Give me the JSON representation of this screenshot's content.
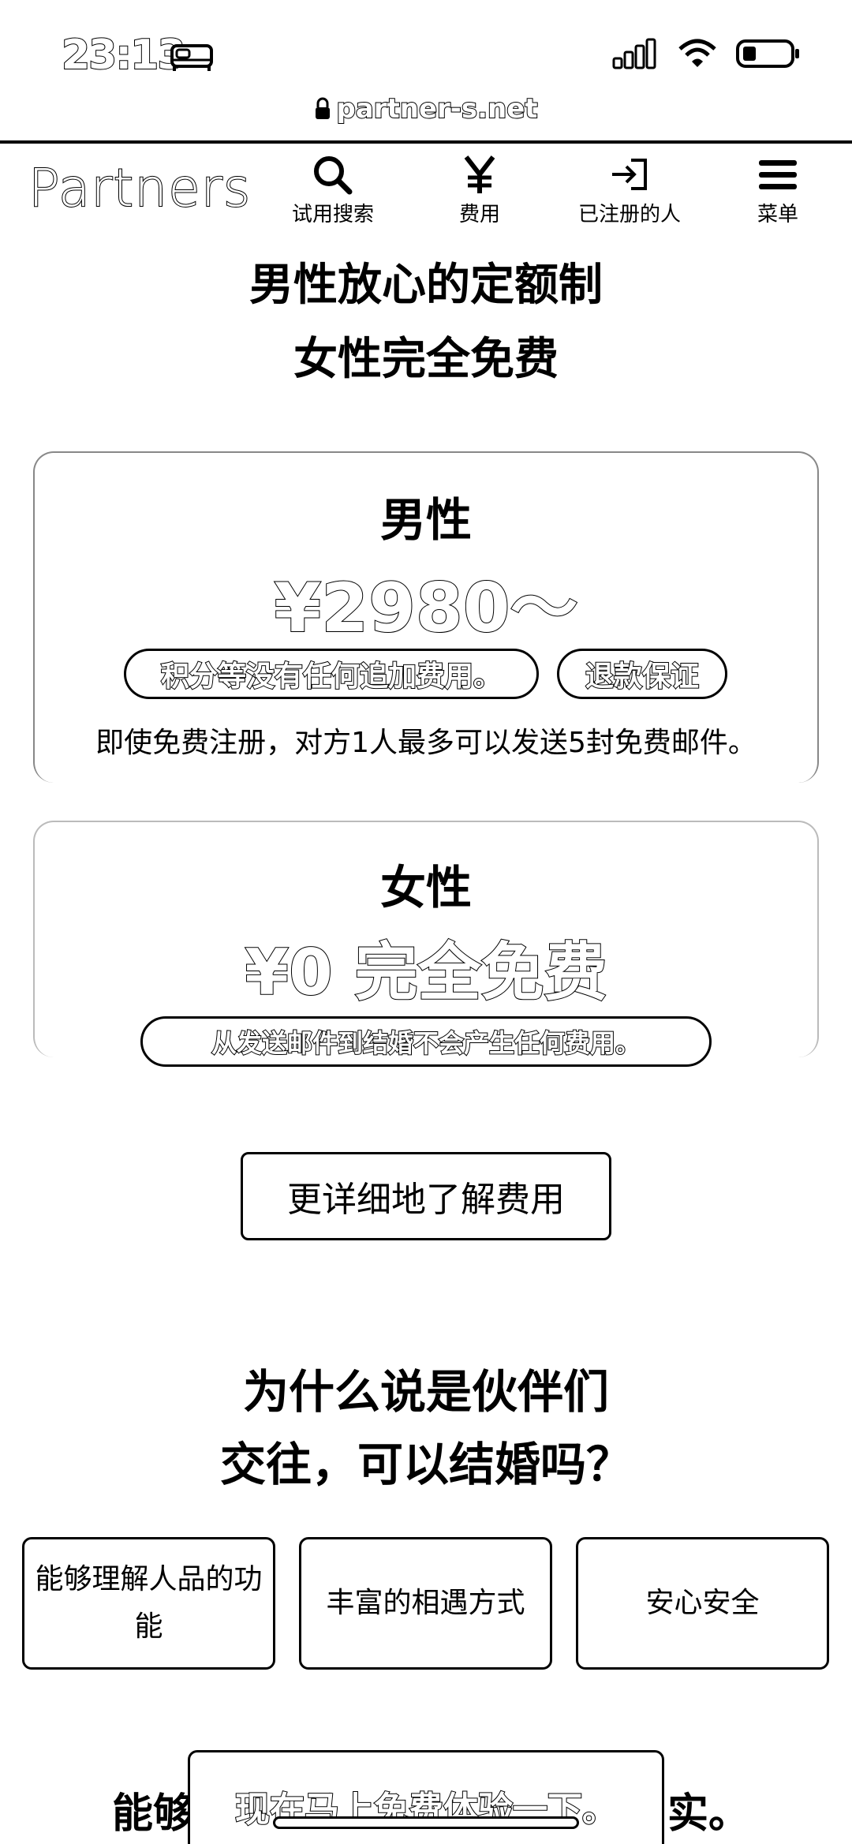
{
  "status_bar": {
    "time": "23:13"
  },
  "url": "partner-s.net",
  "nav": {
    "logo": "Partners",
    "items": [
      {
        "label": "试用搜索",
        "icon": "search-icon"
      },
      {
        "label": "费用",
        "icon": "yen-icon"
      },
      {
        "label": "已注册的人",
        "icon": "login-icon"
      },
      {
        "label": "菜单",
        "icon": "hamburger-menu-icon"
      }
    ]
  },
  "headline": {
    "line1": "男性放心的定额制",
    "line2": "女性完全免费"
  },
  "male_card": {
    "title": "男性",
    "price": "¥2980～",
    "pill_no_extra": "积分等没有任何追加费用。",
    "pill_refund": "退款保证",
    "note": "即使免费注册，对方1人最多可以发送5封免费邮件。"
  },
  "female_card": {
    "title": "女性",
    "price": "¥0 完全免费",
    "pill_no_cost": "从发送邮件到结婚不会产生任何费用。"
  },
  "detail_button": "更详细地了解费用",
  "why_section": {
    "line1": "为什么说是伙伴们",
    "line2": "交往，可以结婚吗？",
    "features": [
      "能够理解人品的功能",
      "丰富的相遇方式",
      "安心安全"
    ]
  },
  "bottom_partial": {
    "left": "能够",
    "right": "实。"
  },
  "cta_button": "现在马上免费体验一下。"
}
